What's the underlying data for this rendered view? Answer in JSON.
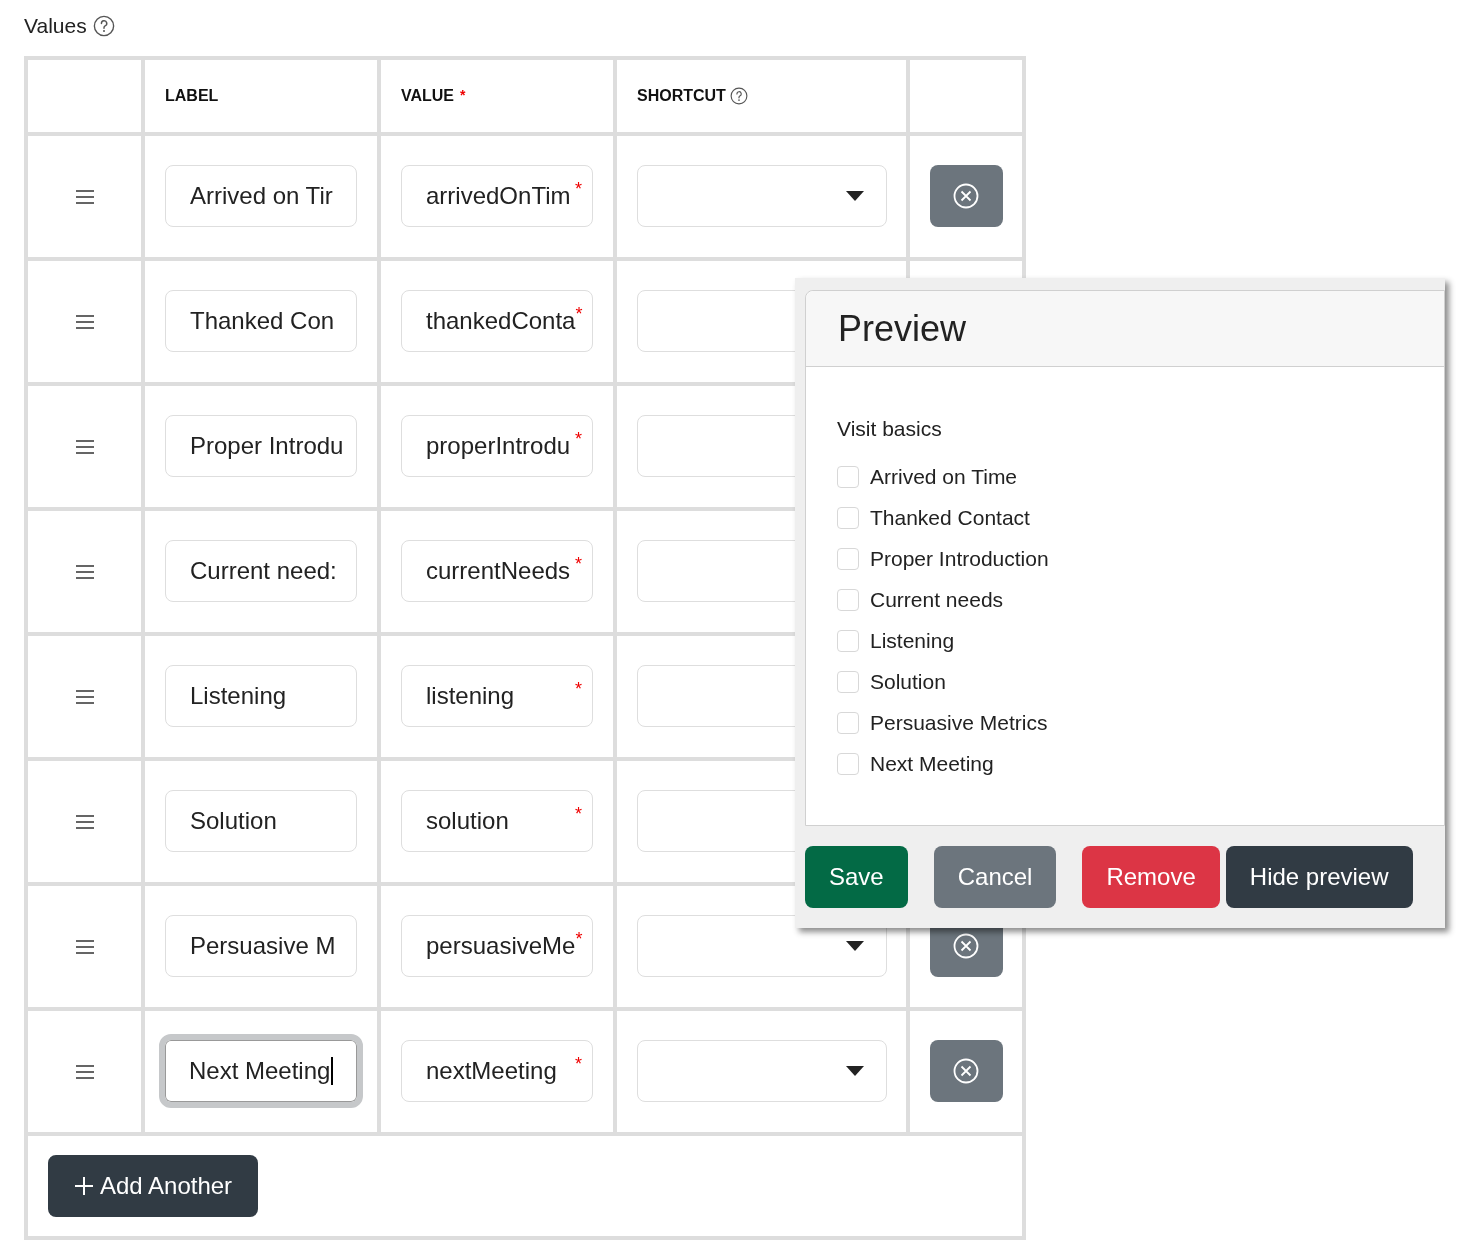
{
  "section_label": "Values",
  "columns": [
    {},
    {
      "label": "LABEL"
    },
    {
      "label": "VALUE",
      "required_mark": "*"
    },
    {
      "label": "SHORTCUT",
      "help": true
    },
    {}
  ],
  "rows": [
    {
      "label": "Arrived on Tir",
      "value": "arrivedOnTim",
      "required_mark": "*",
      "focused": false,
      "remove_button": true
    },
    {
      "label": "Thanked Con",
      "value": "thankedConta",
      "required_mark": "*",
      "focused": false
    },
    {
      "label": "Proper Introdu",
      "value": "properIntrodu",
      "required_mark": "*",
      "focused": false
    },
    {
      "label": "Current need:",
      "value": "currentNeeds",
      "required_mark": "*",
      "focused": false
    },
    {
      "label": "Listening",
      "value": "listening",
      "required_mark": "*",
      "focused": false
    },
    {
      "label": "Solution",
      "value": "solution",
      "required_mark": "*",
      "focused": false
    },
    {
      "label": "Persuasive M",
      "value": "persuasiveMe",
      "required_mark": "*",
      "focused": false,
      "remove_button": true
    },
    {
      "label": "Next Meeting",
      "value": "nextMeeting",
      "required_mark": "*",
      "focused": true,
      "remove_button": true
    }
  ],
  "add_button": "Add Another",
  "preview": {
    "title": "Preview",
    "group_label": "Visit basics",
    "options": [
      {
        "label": "Arrived on Time",
        "checked": false
      },
      {
        "label": "Thanked Contact",
        "checked": false
      },
      {
        "label": "Proper Introduction",
        "checked": false
      },
      {
        "label": "Current needs",
        "checked": false
      },
      {
        "label": "Listening",
        "checked": false
      },
      {
        "label": "Solution",
        "checked": false
      },
      {
        "label": "Persuasive Metrics",
        "checked": false
      },
      {
        "label": "Next Meeting",
        "checked": false
      }
    ],
    "buttons": [
      {
        "label": "Save",
        "kind": "success"
      },
      {
        "label": "Cancel",
        "kind": "secondary"
      },
      {
        "label": "Remove",
        "kind": "danger"
      },
      {
        "label": "Hide preview",
        "kind": "dark"
      }
    ]
  }
}
